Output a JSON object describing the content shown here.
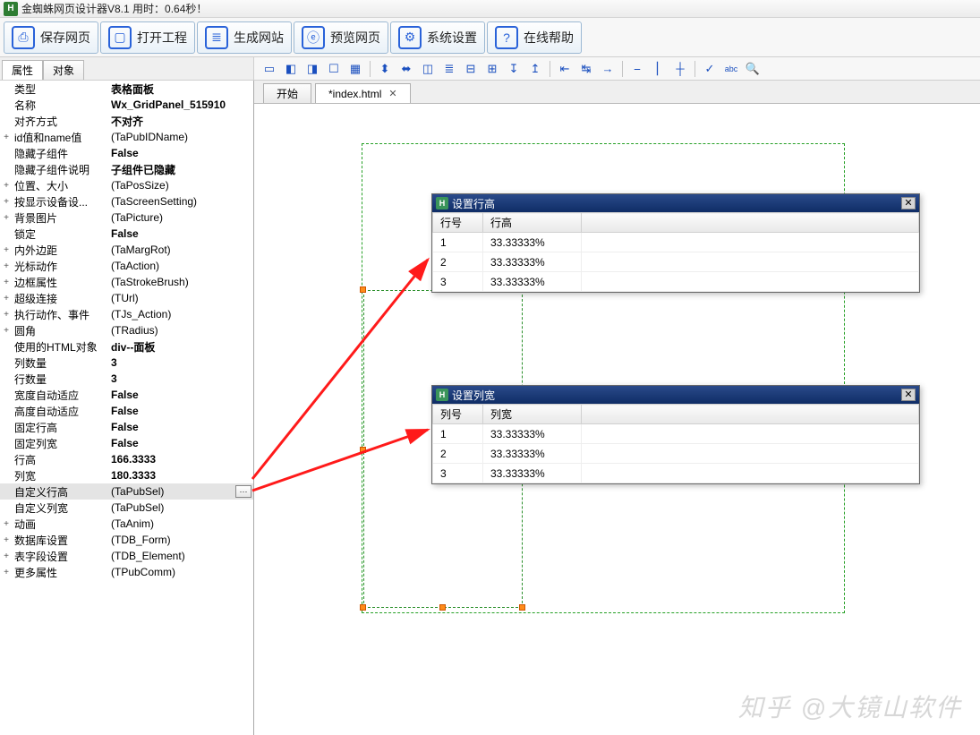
{
  "title": "金蜘蛛网页设计器V8.1 用时：0.64秒！",
  "logo_letter": "H",
  "toolbar": [
    {
      "name": "save-page-button",
      "icon": "save-icon",
      "glyph": "⎙",
      "label": "保存网页"
    },
    {
      "name": "open-project-button",
      "icon": "open-icon",
      "glyph": "▢",
      "label": "打开工程"
    },
    {
      "name": "build-site-button",
      "icon": "stack-icon",
      "glyph": "≣",
      "label": "生成网站"
    },
    {
      "name": "preview-button",
      "icon": "globe-icon",
      "glyph": "ⓔ",
      "label": "预览网页"
    },
    {
      "name": "settings-button",
      "icon": "gear-icon",
      "glyph": "⚙",
      "label": "系统设置"
    },
    {
      "name": "help-button",
      "icon": "help-icon",
      "glyph": "?",
      "label": "在线帮助"
    }
  ],
  "panel_tabs": {
    "prop": "属性",
    "obj": "对象"
  },
  "iconstrip": [
    {
      "name": "tool-icon-1",
      "glyph": "▭"
    },
    {
      "name": "tool-icon-2",
      "glyph": "◧"
    },
    {
      "name": "tool-icon-3",
      "glyph": "◨"
    },
    {
      "name": "tool-icon-4",
      "glyph": "☐"
    },
    {
      "name": "tool-icon-5",
      "glyph": "▦"
    },
    {
      "sep": true
    },
    {
      "name": "tool-icon-6",
      "glyph": "⬍"
    },
    {
      "name": "tool-icon-7",
      "glyph": "⬌"
    },
    {
      "name": "tool-icon-8",
      "glyph": "◫"
    },
    {
      "name": "tool-icon-9",
      "glyph": "≣"
    },
    {
      "name": "tool-icon-10",
      "glyph": "⊟"
    },
    {
      "name": "tool-icon-11",
      "glyph": "⊞"
    },
    {
      "name": "tool-icon-12",
      "glyph": "↧"
    },
    {
      "name": "tool-icon-13",
      "glyph": "↥"
    },
    {
      "sep": true
    },
    {
      "name": "tool-icon-14",
      "glyph": "⇤"
    },
    {
      "name": "tool-icon-15",
      "glyph": "↹"
    },
    {
      "name": "tool-icon-16",
      "glyph": "→"
    },
    {
      "sep": true
    },
    {
      "name": "tool-icon-17",
      "glyph": "⎯"
    },
    {
      "name": "tool-icon-18",
      "glyph": "⎢"
    },
    {
      "name": "tool-icon-19",
      "glyph": "┼"
    },
    {
      "sep": true
    },
    {
      "name": "tool-icon-20",
      "glyph": "✓"
    },
    {
      "name": "tool-icon-21",
      "glyph": "abc"
    },
    {
      "name": "tool-icon-22",
      "glyph": "🔍"
    }
  ],
  "doctabs": [
    {
      "name": "doc-tab-start",
      "label": "开始",
      "close": false,
      "active": false
    },
    {
      "name": "doc-tab-index",
      "label": "*index.html",
      "close": true,
      "active": true
    }
  ],
  "props": [
    {
      "exp": "",
      "name": "类型",
      "val": "表格面板",
      "bold": true
    },
    {
      "exp": "",
      "name": "名称",
      "val": "Wx_GridPanel_515910",
      "bold": true
    },
    {
      "exp": "",
      "name": "对齐方式",
      "val": "不对齐",
      "bold": true
    },
    {
      "exp": "+",
      "name": "id值和name值",
      "val": "(TaPubIDName)",
      "bold": false
    },
    {
      "exp": "",
      "name": "隐藏子组件",
      "val": "False",
      "bold": true
    },
    {
      "exp": "",
      "name": "隐藏子组件说明",
      "val": "子组件已隐藏",
      "bold": true
    },
    {
      "exp": "+",
      "name": "位置、大小",
      "val": "(TaPosSize)",
      "bold": false
    },
    {
      "exp": "+",
      "name": "按显示设备设...",
      "val": "(TaScreenSetting)",
      "bold": false
    },
    {
      "exp": "+",
      "name": "背景图片",
      "val": "(TaPicture)",
      "bold": false
    },
    {
      "exp": "",
      "name": "锁定",
      "val": "False",
      "bold": true
    },
    {
      "exp": "+",
      "name": "内外边距",
      "val": "(TaMargRot)",
      "bold": false
    },
    {
      "exp": "+",
      "name": "光标动作",
      "val": "(TaAction)",
      "bold": false
    },
    {
      "exp": "+",
      "name": "边框属性",
      "val": "(TaStrokeBrush)",
      "bold": false
    },
    {
      "exp": "+",
      "name": "超级连接",
      "val": "(TUrl)",
      "bold": false
    },
    {
      "exp": "+",
      "name": "执行动作、事件",
      "val": "(TJs_Action)",
      "bold": false
    },
    {
      "exp": "+",
      "name": "圆角",
      "val": "(TRadius)",
      "bold": false
    },
    {
      "exp": "",
      "name": "使用的HTML对象",
      "val": "div--面板",
      "bold": true
    },
    {
      "exp": "",
      "name": "列数量",
      "val": "3",
      "bold": true
    },
    {
      "exp": "",
      "name": "行数量",
      "val": "3",
      "bold": true
    },
    {
      "exp": "",
      "name": "宽度自动适应",
      "val": "False",
      "bold": true
    },
    {
      "exp": "",
      "name": "高度自动适应",
      "val": "False",
      "bold": true
    },
    {
      "exp": "",
      "name": "固定行高",
      "val": "False",
      "bold": true
    },
    {
      "exp": "",
      "name": "固定列宽",
      "val": "False",
      "bold": true
    },
    {
      "exp": "",
      "name": "行高",
      "val": "166.3333",
      "bold": true
    },
    {
      "exp": "",
      "name": "列宽",
      "val": "180.3333",
      "bold": true
    },
    {
      "exp": "",
      "name": "自定义行高",
      "val": "(TaPubSel)",
      "bold": false,
      "selected": true
    },
    {
      "exp": "",
      "name": "自定义列宽",
      "val": "(TaPubSel)",
      "bold": false
    },
    {
      "exp": "+",
      "name": "动画",
      "val": "(TaAnim)",
      "bold": false
    },
    {
      "exp": "+",
      "name": "数据库设置",
      "val": "(TDB_Form)",
      "bold": false
    },
    {
      "exp": "+",
      "name": "表字段设置",
      "val": "(TDB_Element)",
      "bold": false
    },
    {
      "exp": "+",
      "name": "更多属性",
      "val": "(TPubComm)",
      "bold": false
    }
  ],
  "popup_row": {
    "title": "设置行高",
    "head1": "行号",
    "head2": "行高",
    "rows": [
      {
        "n": "1",
        "v": "33.33333%"
      },
      {
        "n": "2",
        "v": "33.33333%"
      },
      {
        "n": "3",
        "v": "33.33333%"
      }
    ]
  },
  "popup_col": {
    "title": "设置列宽",
    "head1": "列号",
    "head2": "列宽",
    "rows": [
      {
        "n": "1",
        "v": "33.33333%"
      },
      {
        "n": "2",
        "v": "33.33333%"
      },
      {
        "n": "3",
        "v": "33.33333%"
      }
    ]
  },
  "edit_btn": "···",
  "close_btn": "✕",
  "watermark": "知乎 @大镜山软件"
}
